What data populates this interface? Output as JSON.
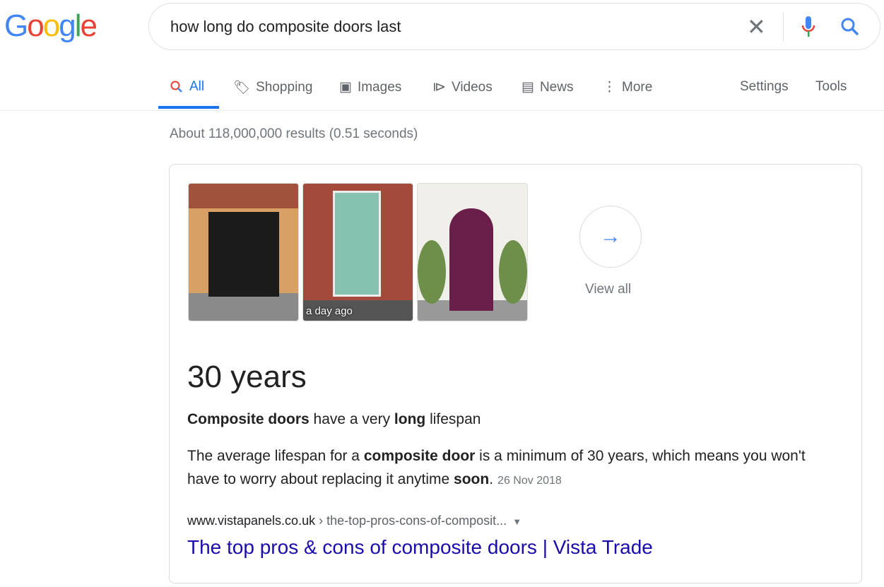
{
  "logo": "Google",
  "search": {
    "query": "how long do composite doors last"
  },
  "tabs": [
    {
      "label": "All"
    },
    {
      "label": "Shopping"
    },
    {
      "label": "Images"
    },
    {
      "label": "Videos"
    },
    {
      "label": "News"
    },
    {
      "label": "More"
    },
    {
      "label": "Settings"
    },
    {
      "label": "Tools"
    }
  ],
  "stats": "About 118,000,000 results (0.51 seconds)",
  "snippet": {
    "images": [
      {
        "timestamp": ""
      },
      {
        "timestamp": "a day ago"
      },
      {
        "timestamp": ""
      }
    ],
    "view_all": "View all",
    "answer": "30 years",
    "heading": [
      {
        "t": "Composite doors",
        "b": true
      },
      {
        "t": " have a very ",
        "b": false
      },
      {
        "t": "long",
        "b": true
      },
      {
        "t": " lifespan",
        "b": false
      }
    ],
    "body": [
      {
        "t": "The average lifespan for a ",
        "b": false
      },
      {
        "t": "composite door",
        "b": true
      },
      {
        "t": " is a minimum of 30 years, which means you won't have to worry about replacing it anytime ",
        "b": false
      },
      {
        "t": "soon",
        "b": true
      },
      {
        "t": ".",
        "b": false
      }
    ],
    "date": "26 Nov 2018",
    "url_domain": "www.vistapanels.co.uk",
    "url_path": " › the-top-pros-cons-of-composit...",
    "result_title": "The top pros & cons of composite doors | Vista Trade"
  },
  "colors": {
    "accent": "#1a73e8",
    "link": "#1a0dab"
  }
}
